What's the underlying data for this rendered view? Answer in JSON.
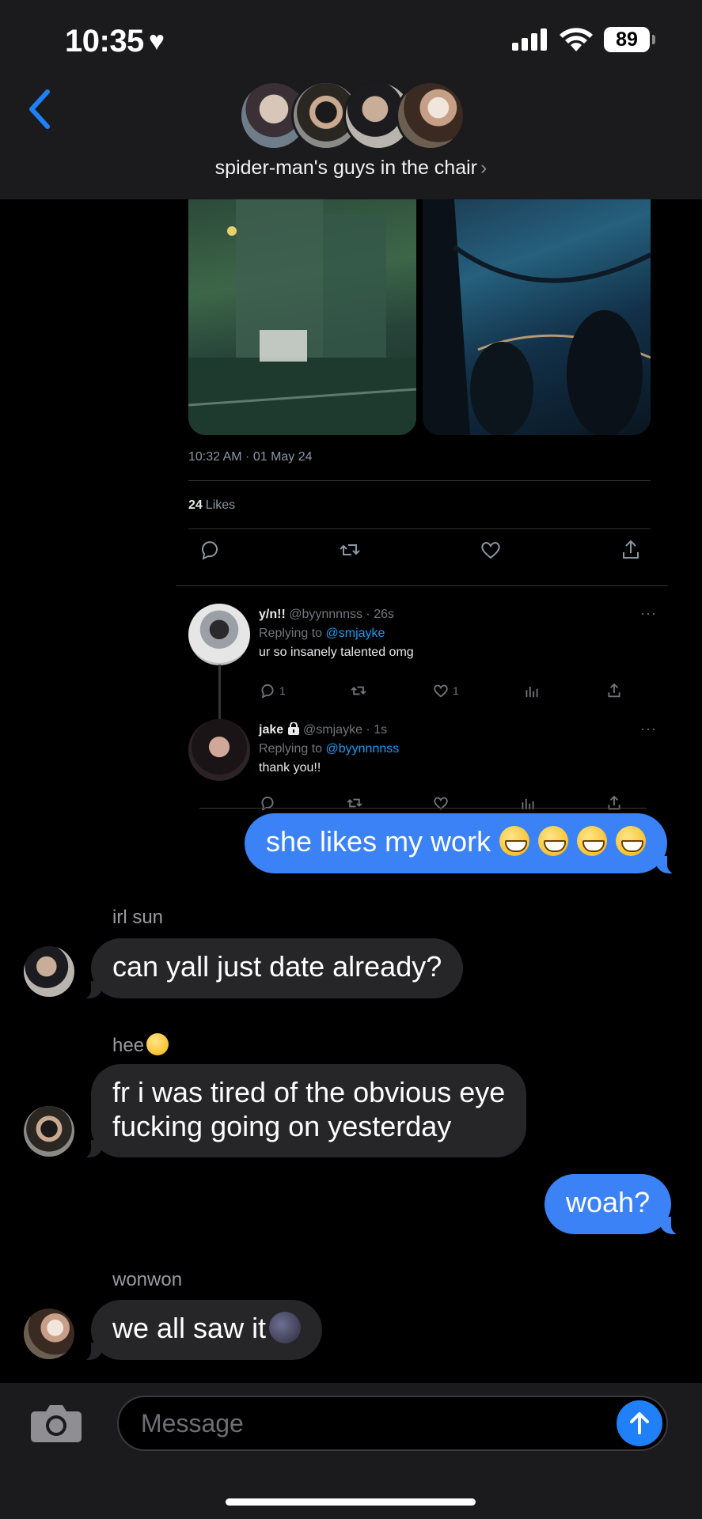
{
  "status_bar": {
    "time": "10:35",
    "battery": "89"
  },
  "header": {
    "group_name": "spider-man's guys in the chair",
    "chevron": "›"
  },
  "shared_tweet": {
    "timestamp": "10:32 AM · 01 May 24",
    "likes_count": "24",
    "likes_label": "Likes",
    "replies": [
      {
        "name": "y/n!!",
        "handle": "@byynnnnss · 26s",
        "replying_prefix": "Replying to",
        "replying_to": "@smjayke",
        "text": "ur so insanely talented omg",
        "reply_count": "1",
        "like_count": "1"
      },
      {
        "name": "jake",
        "handle": "@smjayke · 1s",
        "replying_prefix": "Replying to",
        "replying_to": "@byynnnnss",
        "text": "thank you!!"
      }
    ],
    "more": "···"
  },
  "messages": {
    "m1": {
      "text": "she likes my work"
    },
    "m2": {
      "sender": "irl sun",
      "text": "can yall just date already?"
    },
    "m3": {
      "sender": "hee",
      "text_line1": "fr i was tired of the obvious eye",
      "text_line2": "fucking going on yesterday"
    },
    "m4": {
      "text": "woah?"
    },
    "m5": {
      "sender": "wonwon",
      "text": "we all saw it"
    }
  },
  "composer": {
    "placeholder": "Message"
  },
  "colors": {
    "outgoing_bubble": "#3b82f6",
    "incoming_bubble": "#262629",
    "link_blue": "#1d9bf0",
    "back_chevron": "#1f80f7"
  }
}
